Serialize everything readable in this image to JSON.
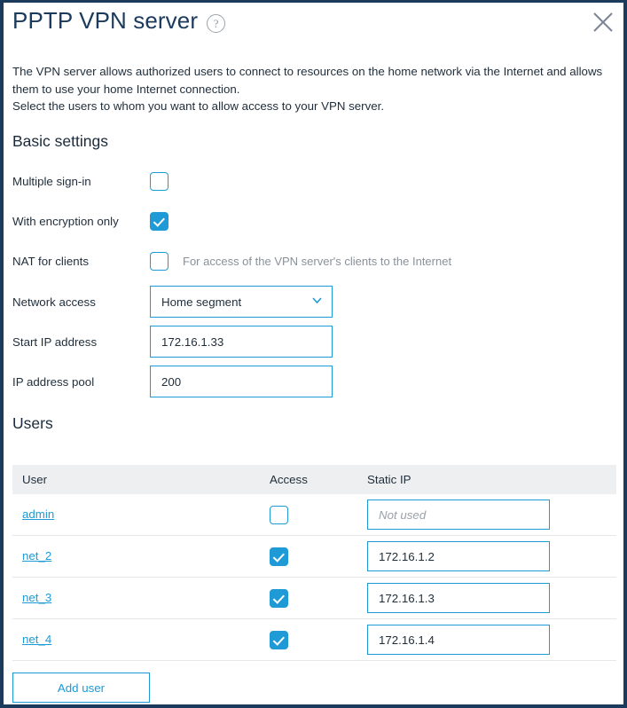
{
  "dialog": {
    "title": "PPTP VPN server",
    "help_icon": "question-mark-icon",
    "close_icon": "close-icon",
    "description_line1": "The VPN server allows authorized users to connect to resources on the home network via the Internet and allows them to use your home Internet connection.",
    "description_line2": "Select the users to whom you want to allow access to your VPN server."
  },
  "basic_settings": {
    "heading": "Basic settings",
    "rows": [
      {
        "label": "Multiple sign-in",
        "checked": false,
        "hint": ""
      },
      {
        "label": "With encryption only",
        "checked": true,
        "hint": ""
      },
      {
        "label": "NAT for clients",
        "checked": false,
        "hint": "For access of the VPN server's clients to the Internet"
      }
    ],
    "network_access": {
      "label": "Network access",
      "value": "Home segment",
      "options": [
        "Home segment"
      ],
      "chevron_icon": "chevron-down-icon"
    },
    "start_ip": {
      "label": "Start IP address",
      "value": "172.16.1.33",
      "placeholder": ""
    },
    "ip_pool": {
      "label": "IP address pool",
      "value": "200",
      "placeholder": ""
    }
  },
  "users": {
    "heading": "Users",
    "columns": [
      "User",
      "Access",
      "Static IP"
    ],
    "rows": [
      {
        "user": "admin",
        "access": false,
        "static_ip": "",
        "static_ip_placeholder": "Not used"
      },
      {
        "user": "net_2",
        "access": true,
        "static_ip": "172.16.1.2",
        "static_ip_placeholder": "Not used"
      },
      {
        "user": "net_3",
        "access": true,
        "static_ip": "172.16.1.3",
        "static_ip_placeholder": "Not used"
      },
      {
        "user": "net_4",
        "access": true,
        "static_ip": "172.16.1.4",
        "static_ip_placeholder": "Not used"
      }
    ],
    "add_user_label": "Add user"
  },
  "colors": {
    "accent_blue": "#1e9ad6",
    "title_navy": "#1b3a5c",
    "border_navy": "#1b3a5c",
    "text_dark": "#1f2d3a",
    "hint_gray": "#8a9199",
    "table_header_gray": "#eeeff0"
  }
}
